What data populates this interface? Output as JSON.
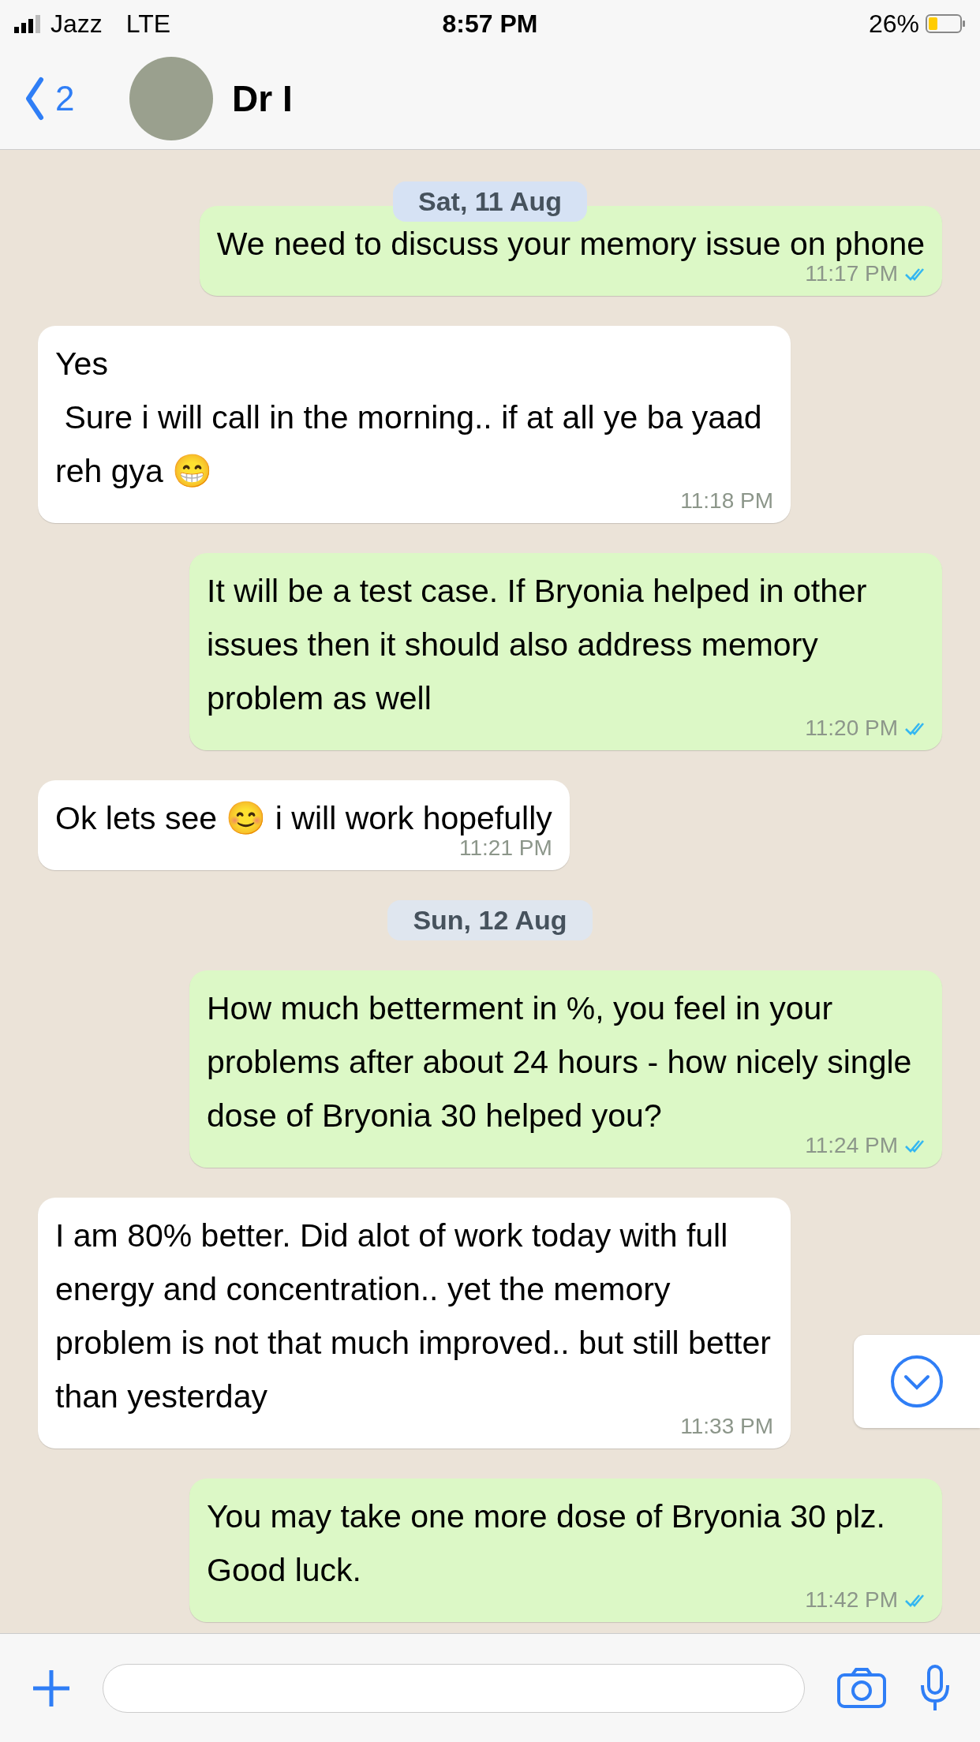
{
  "status_bar": {
    "carrier": "Jazz",
    "network": "LTE",
    "time": "8:57 PM",
    "battery": "26%"
  },
  "header": {
    "back_count": "2",
    "contact_name": "Dr I"
  },
  "messages": [
    {
      "kind": "date",
      "text": "Sat, 11 Aug"
    },
    {
      "kind": "outgoing",
      "text": "We need to discuss your memory issue on phone",
      "time": "11:17 PM",
      "read": true
    },
    {
      "kind": "incoming",
      "text": "Yes\n Sure i will call in the morning.. if at all ye ba yaad reh gya 😁",
      "time": "11:18 PM"
    },
    {
      "kind": "outgoing",
      "text": "It will be a test case. If Bryonia helped in other issues then it should also address memory problem as well",
      "time": "11:20 PM",
      "read": true
    },
    {
      "kind": "incoming",
      "text": "Ok lets see 😊 i will work hopefully",
      "time": "11:21 PM"
    },
    {
      "kind": "date",
      "text": "Sun, 12 Aug"
    },
    {
      "kind": "outgoing",
      "text": "How much betterment in %, you feel in your problems after about 24 hours - how nicely single dose of Bryonia 30 helped you?",
      "time": "11:24 PM",
      "read": true
    },
    {
      "kind": "incoming",
      "text": "I am 80% better. Did alot of work today with full energy and concentration.. yet the memory problem is not that much improved.. but still better than yesterday",
      "time": "11:33 PM"
    },
    {
      "kind": "outgoing",
      "text": "You may take one more dose of Bryonia 30 plz. Good luck.",
      "time": "11:42 PM",
      "read": true
    }
  ]
}
